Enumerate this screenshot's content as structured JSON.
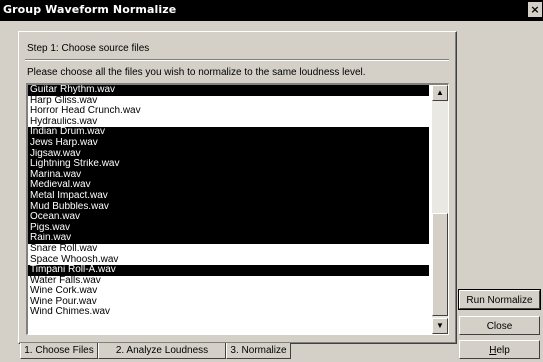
{
  "window": {
    "title": "Group Waveform Normalize",
    "close_glyph": "×"
  },
  "step": {
    "label": "Step 1:  Choose source files"
  },
  "instruction": "Please choose all the files you wish to normalize to the same loudness level.",
  "files": [
    {
      "name": "Guitar Rhythm.wav",
      "selected": true
    },
    {
      "name": "Harp Gliss.wav",
      "selected": false
    },
    {
      "name": "Horror Head Crunch.wav",
      "selected": false
    },
    {
      "name": "Hydraulics.wav",
      "selected": false
    },
    {
      "name": "Indian Drum.wav",
      "selected": true
    },
    {
      "name": "Jews Harp.wav",
      "selected": true
    },
    {
      "name": "Jigsaw.wav",
      "selected": true
    },
    {
      "name": "Lightning Strike.wav",
      "selected": true
    },
    {
      "name": "Marina.wav",
      "selected": true
    },
    {
      "name": "Medieval.wav",
      "selected": true
    },
    {
      "name": "Metal Impact.wav",
      "selected": true
    },
    {
      "name": "Mud Bubbles.wav",
      "selected": true
    },
    {
      "name": "Ocean.wav",
      "selected": true
    },
    {
      "name": "Pigs.wav",
      "selected": true
    },
    {
      "name": "Rain.wav",
      "selected": true
    },
    {
      "name": "Snare Roll.wav",
      "selected": false
    },
    {
      "name": "Space Whoosh.wav",
      "selected": false
    },
    {
      "name": "Timpani Roll-A.wav",
      "selected": true
    },
    {
      "name": "Water Falls.wav",
      "selected": false
    },
    {
      "name": "Wine Cork.wav",
      "selected": false
    },
    {
      "name": "Wine Pour.wav",
      "selected": false
    },
    {
      "name": "Wind Chimes.wav",
      "selected": false
    }
  ],
  "scrollbar": {
    "up_glyph": "▲",
    "down_glyph": "▼",
    "position": 0.53
  },
  "tabs": [
    {
      "label": "1. Choose Files",
      "active": true
    },
    {
      "label": "2. Analyze Loudness",
      "active": false
    },
    {
      "label": "3. Normalize",
      "active": false
    }
  ],
  "buttons": {
    "run_normalize": "Run Normalize",
    "close": "Close",
    "help": "Help"
  },
  "colors": {
    "titlebar": "#000000",
    "selection": "#000000",
    "face": "#d4d0c8"
  }
}
